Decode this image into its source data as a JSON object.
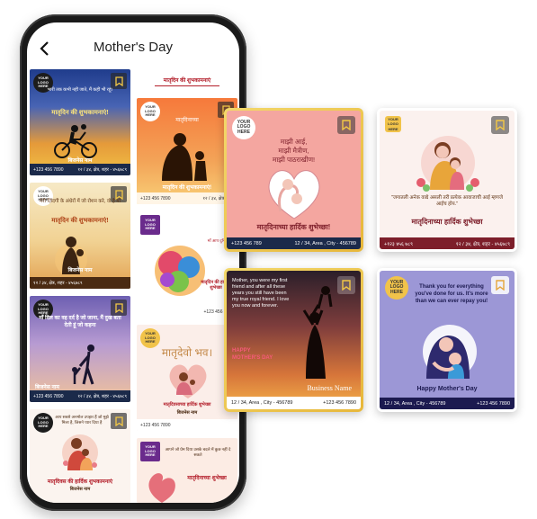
{
  "header": {
    "title": "Mother's Day"
  },
  "logo_badge": "YOUR LOGO HERE",
  "phone_cards": {
    "c1": {
      "line1": "भारी तक कभी नहीं जाते, मैं कहीं भी रहूं।",
      "title": "मातृदिन की शुभकामनाएं!",
      "biz": "बिजनेस नाम",
      "phone": "+123 456 7890",
      "addr": "१२ / ३४, क्षेत्र, शहर - ४५६७८९"
    },
    "c2": {
      "top": "मातृदिन की शुभकामनाएं",
      "title": "मातृदिन की शुभकामनाएं!",
      "biz": "बिजनेस नाम",
      "phone": "+123 456 7890",
      "addr": "१२ / ३४, क्षेत्र, शहर"
    },
    "c3": {
      "line1": "मेरी ज़िंदगी के अंधेरों में जो रोशन करे, वो है माँ",
      "title": "मातृदिन की शुभकामनाएं!",
      "biz": "बिजनेस नाम",
      "addr": "१२ / ३४, क्षेत्र, शहर - ४५६७८९"
    },
    "c4": {
      "line1": "माँ आप दुनिया की सबसे",
      "title": "मातृदिन की हार्दिक शुभेच्छा",
      "phone": "+123 456 7890"
    },
    "c5": {
      "line1": "माँ दिल का वह दर्द है जो जाना, मैं दुख बता देती हूं जो कहना",
      "biz": "बिजनेस नाम",
      "phone": "+123 456 7890",
      "addr": "१२ / ३४, क्षेत्र, शहर - ४५६७८९"
    },
    "c6": {
      "title": "मातृदेवो भव।",
      "subtitle": "मातृदिवसाच्या हार्दिक शुभेच्छा",
      "biz": "बिजनेस नाम",
      "phone": "+123 456 7890"
    },
    "c7": {
      "line1": "आप सबसे अनमोल उपहार हैं जो मुझे मिला है, जिसने प्यार दिया है",
      "title": "मातृदिवस की हार्दिक शुभकामनाएं",
      "biz": "बिजनेस नाम"
    },
    "c8": {
      "line1": "आपने जो प्रेम दिया उसके बदले में कुछ नहीं दे सकते",
      "title": "मातृदिनाच्या शुभेच्छा"
    }
  },
  "float_cards": {
    "f1": {
      "line1": "माझी आई,",
      "line2": "माझी मैत्रीण,",
      "line3": "माझी पाठराखीण!",
      "title": "मातृदिनाच्या हार्दिक शुभेच्छा!",
      "phone": "+123 456 789",
      "addr": "12 / 34, Area , City - 456789"
    },
    "f2": {
      "quote": "\"जगातली अनेक वाद्ये असली तरी प्रत्येक आवाजाची आई म्हणजे आईच होय.\"",
      "title": "मातृदिनाच्या हार्दिक शुभेच्छा",
      "phone": "+१२३ ४५६ ७८९",
      "addr": "१२ / ३४, क्षेत्र, शहर - ४५६७८९"
    },
    "f3": {
      "quote": "Mother, you were my first friend and after all these years you still have been my true royal friend. I love you now and forever.",
      "title1": "HAPPY",
      "title2": "MOTHER'S DAY",
      "biz": "Business Name",
      "addr": "12 / 34, Area , City - 456789",
      "phone": "+123 456 7890"
    },
    "f4": {
      "quote": "Thank you for everything you've done for us. It's more than we can ever repay you!",
      "title": "Happy Mother's Day",
      "addr": "12 / 34, Area , City - 456789",
      "phone": "+123 456 7890"
    }
  },
  "colors": {
    "pink_bg": "#f4a6a0",
    "navy": "#1b2a4a",
    "maroon": "#7d1e2a",
    "lavender": "#9c97d6",
    "gold_border": "#e8c04a"
  }
}
